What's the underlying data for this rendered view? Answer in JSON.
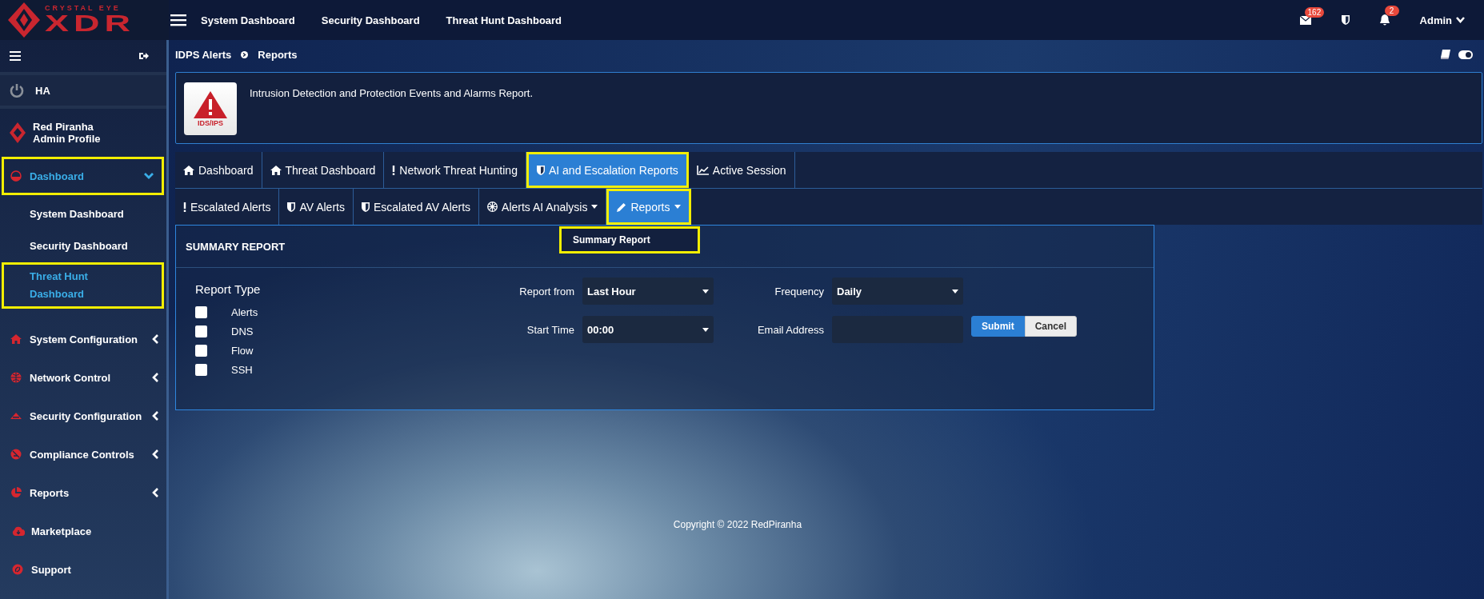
{
  "logo": {
    "tagline": "CRYSTAL EYE",
    "wordmark": "XDR"
  },
  "top_nav": [
    {
      "label": "System Dashboard"
    },
    {
      "label": "Security Dashboard"
    },
    {
      "label": "Threat Hunt Dashboard"
    }
  ],
  "top_icons": {
    "mail_count": "162",
    "notification_count": "2",
    "user": "Admin"
  },
  "sidebar": {
    "ha": "HA",
    "profile": {
      "name": "Red Piranha",
      "role": "Admin Profile"
    },
    "items": [
      {
        "label": "Dashboard",
        "kind": "menu",
        "selected": true,
        "expanded": true,
        "highlighted": true,
        "children": [
          {
            "label": "System Dashboard",
            "selected": false,
            "highlighted": false
          },
          {
            "label": "Security Dashboard",
            "selected": false,
            "highlighted": false
          },
          {
            "label": "Threat Hunt Dashboard",
            "selected": true,
            "highlighted": true
          }
        ]
      },
      {
        "label": "System Configuration",
        "kind": "menu",
        "selected": false,
        "expanded": false,
        "highlighted": false
      },
      {
        "label": "Network Control",
        "kind": "menu",
        "selected": false,
        "expanded": false,
        "highlighted": false
      },
      {
        "label": "Security Configuration",
        "kind": "menu",
        "selected": false,
        "expanded": false,
        "highlighted": false
      },
      {
        "label": "Compliance Controls",
        "kind": "menu",
        "selected": false,
        "expanded": false,
        "highlighted": false
      },
      {
        "label": "Reports",
        "kind": "menu",
        "selected": false,
        "expanded": false,
        "highlighted": false
      },
      {
        "label": "Marketplace",
        "kind": "link",
        "selected": false,
        "highlighted": false
      },
      {
        "label": "Support",
        "kind": "link",
        "selected": false,
        "highlighted": false
      }
    ]
  },
  "breadcrumb": [
    "IDPS Alerts",
    "Reports"
  ],
  "banner": {
    "badge": "IDS/IPS",
    "text": "Intrusion Detection and Protection Events and Alarms Report."
  },
  "tabs": [
    {
      "label": "Dashboard",
      "selected": false,
      "highlighted": false
    },
    {
      "label": "Threat Dashboard",
      "selected": false,
      "highlighted": false
    },
    {
      "label": "Network Threat Hunting",
      "selected": false,
      "highlighted": false
    },
    {
      "label": "AI and Escalation Reports",
      "selected": true,
      "highlighted": true
    },
    {
      "label": "Active Session",
      "selected": false,
      "highlighted": false
    }
  ],
  "sub_tabs": [
    {
      "label": "Escalated Alerts",
      "selected": false,
      "highlighted": false,
      "dropdown": false
    },
    {
      "label": "AV Alerts",
      "selected": false,
      "highlighted": false,
      "dropdown": false
    },
    {
      "label": "Escalated AV Alerts",
      "selected": false,
      "highlighted": false,
      "dropdown": false
    },
    {
      "label": "Alerts AI Analysis",
      "selected": false,
      "highlighted": false,
      "dropdown": true
    },
    {
      "label": "Reports",
      "selected": true,
      "highlighted": true,
      "dropdown": true
    }
  ],
  "dropdown_menu": [
    {
      "label": "Summary Report",
      "highlighted": true
    }
  ],
  "panel": {
    "title": "SUMMARY REPORT",
    "report_type_label": "Report Type",
    "report_types": [
      {
        "label": "Alerts",
        "checked": false
      },
      {
        "label": "DNS",
        "checked": false
      },
      {
        "label": "Flow",
        "checked": false
      },
      {
        "label": "SSH",
        "checked": false
      }
    ],
    "fields": [
      {
        "label": "Report from",
        "kind": "select",
        "value": "Last Hour"
      },
      {
        "label": "Frequency",
        "kind": "select",
        "value": "Daily"
      },
      {
        "label": "Start Time",
        "kind": "select",
        "value": "00:00"
      },
      {
        "label": "Email Address",
        "kind": "input"
      }
    ],
    "buttons": [
      {
        "label": "Submit",
        "kind": "primary"
      },
      {
        "label": "Cancel",
        "kind": "secondary"
      }
    ]
  },
  "copyright": "Copyright © 2022 RedPiranha"
}
